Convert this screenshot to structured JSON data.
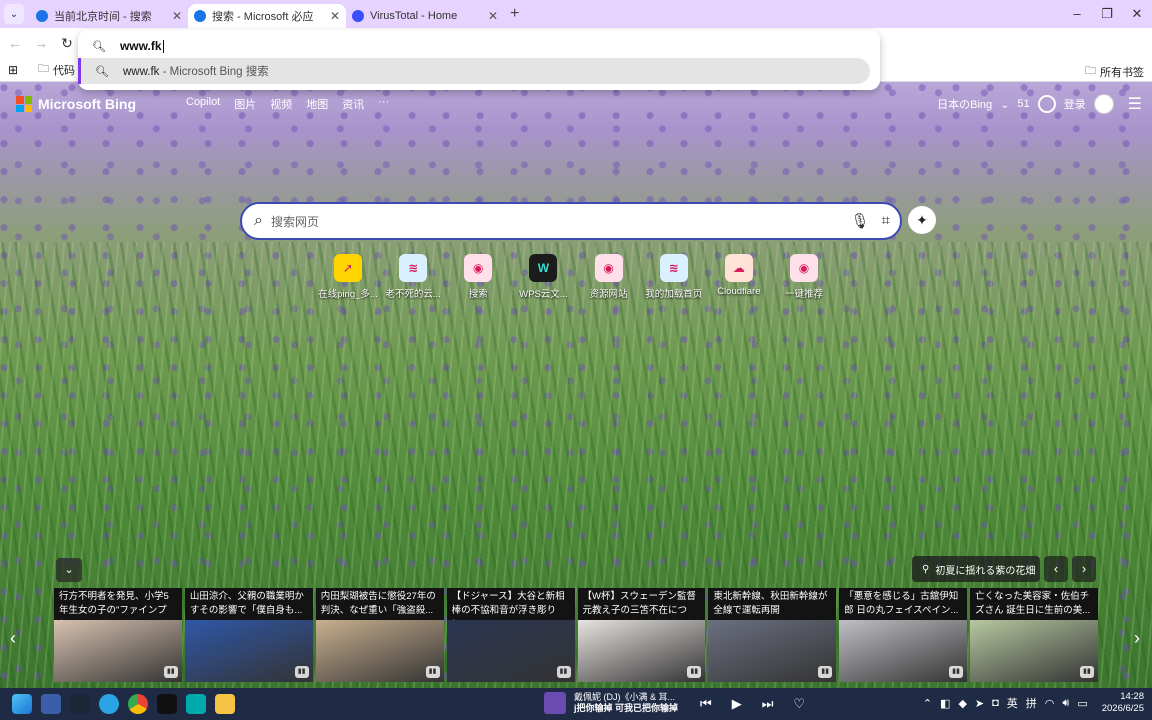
{
  "tabs": [
    {
      "title": "当前北京时间 - 搜索",
      "active": false,
      "color": "#1a73e8"
    },
    {
      "title": "搜索 - Microsoft 必应",
      "active": true,
      "color": "#1a73e8"
    },
    {
      "title": "VirusTotal - Home",
      "active": false,
      "color": "#394eff"
    }
  ],
  "omnibox": {
    "value": "www.fk",
    "suggestion": "www.fk",
    "suggestion_source": "Microsoft Bing 搜索",
    "separator": "-"
  },
  "bookmarks": {
    "folder": "代码",
    "all": "所有书签"
  },
  "bing": {
    "brand": "Microsoft Bing",
    "nav": [
      "Copilot",
      "图片",
      "视频",
      "地图",
      "资讯",
      "···"
    ],
    "region": "日本のBing",
    "points": "51",
    "login": "登录",
    "search_placeholder": "搜索网页",
    "quick": [
      {
        "label": "在线ping_多...",
        "icon": "ping-icon",
        "bg": "#ffd400",
        "glyph": "➚"
      },
      {
        "label": "老不死的云...",
        "icon": "cloud-db-icon",
        "bg": "#d9f0ff",
        "glyph": "≋"
      },
      {
        "label": "搜索",
        "icon": "search-shield-icon",
        "bg": "#ffe0ea",
        "glyph": "◉"
      },
      {
        "label": "WPS云文...",
        "icon": "wps-icon",
        "bg": "#1b1b1b",
        "glyph": "W"
      },
      {
        "label": "资源网站",
        "icon": "shield-icon",
        "bg": "#ffe0ea",
        "glyph": "◉"
      },
      {
        "label": "我的加载首页",
        "icon": "db-icon",
        "bg": "#d9f0ff",
        "glyph": "≋"
      },
      {
        "label": "Cloudflare",
        "icon": "cloudflare-icon",
        "bg": "#ffe3d6",
        "glyph": "☁"
      },
      {
        "label": "一键推荐",
        "icon": "shield-icon-2",
        "bg": "#ffe0ea",
        "glyph": "◉"
      }
    ],
    "location": "初夏に揺れる紫の花畑",
    "news": [
      {
        "text": "行方不明者を発見、小学5年生女の子の\"ファインプレ...",
        "color": "#d8c2b0"
      },
      {
        "text": "山田涼介、父親の職業明かすその影響で「僕自身も...",
        "color": "#2f57a8"
      },
      {
        "text": "内田梨瑚被告に懲役27年の判決、なぜ重い「強盗殺...",
        "color": "#c9b08f"
      },
      {
        "text": "【ドジャース】大谷と新相棒の不協和音が浮き彫りに...",
        "color": "#2a3552"
      },
      {
        "text": "【W杯】スウェーデン監督元教え子の三笘不在につい...",
        "color": "#e7e3e0"
      },
      {
        "text": "東北新幹線、秋田新幹線が全線で運転再開",
        "color": "#6b7080"
      },
      {
        "text": "「悪意を感じる」古舘伊知郎 日の丸フェイスペイン...",
        "color": "#bfc0c4"
      },
      {
        "text": "亡くなった美容家・佐伯チズさん 誕生日に生前の美...",
        "color": "#b7c8a0"
      }
    ]
  },
  "taskbar": {
    "media_title": "戴佩妮 (DJ)《小满 & 耳...",
    "media_sub": "j把你输掉 可我已把你输掉",
    "ime1": "英",
    "ime2": "拼",
    "time": "14:28",
    "date": "2026/6/25"
  }
}
